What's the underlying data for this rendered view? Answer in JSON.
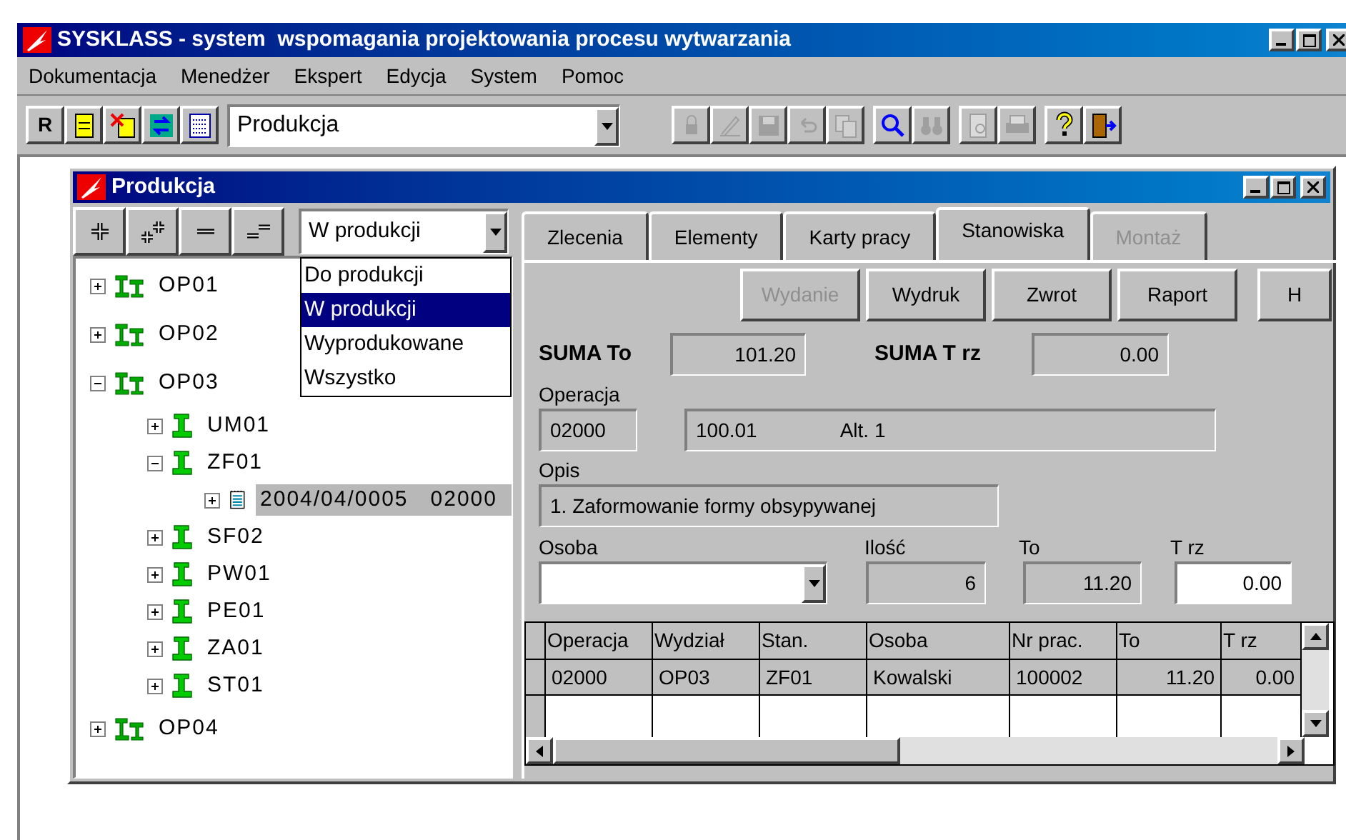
{
  "window": {
    "title": "SYSKLASS - system  wspomagania projektowania procesu wytwarzania"
  },
  "menu": [
    "Dokumentacja",
    "Menedżer",
    "Ekspert",
    "Edycja",
    "System",
    "Pomoc"
  ],
  "toolbar": {
    "letter_button": "R",
    "module": "Produkcja",
    "buttons": [
      {
        "disabled": false
      },
      {
        "disabled": false
      },
      {
        "disabled": false
      },
      {
        "disabled": false
      },
      {
        "disabled": true
      },
      {
        "disabled": true
      },
      {
        "disabled": true
      },
      {
        "disabled": true
      },
      {
        "disabled": true
      },
      {
        "disabled": false
      },
      {
        "disabled": true
      },
      {
        "disabled": true
      },
      {
        "disabled": true
      },
      {
        "disabled": false
      },
      {
        "disabled": false
      }
    ]
  },
  "child_window": {
    "title": "Produkcja",
    "tree_filter": {
      "value": "W produkcji",
      "options": [
        {
          "label": "Do produkcji",
          "selected": false
        },
        {
          "label": "W produkcji",
          "selected": true
        },
        {
          "label": "Wyprodukowane",
          "selected": false
        },
        {
          "label": "Wszystko",
          "selected": false
        }
      ]
    },
    "tree": [
      {
        "kind": "department",
        "label": "OP01",
        "expanded": false,
        "selected": false
      },
      {
        "kind": "department",
        "label": "OP02",
        "expanded": false,
        "selected": false
      },
      {
        "kind": "department",
        "label": "OP03",
        "expanded": true,
        "selected": false,
        "children": [
          {
            "kind": "station",
            "label": "UM01",
            "expanded": false,
            "selected": false
          },
          {
            "kind": "station",
            "label": "ZF01",
            "expanded": true,
            "selected": false,
            "children": [
              {
                "kind": "order",
                "label": "2004/04/0005   02000",
                "expanded": false,
                "selected": true
              }
            ]
          },
          {
            "kind": "station",
            "label": "SF02",
            "expanded": false,
            "selected": false
          },
          {
            "kind": "station",
            "label": "PW01",
            "expanded": false,
            "selected": false
          },
          {
            "kind": "station",
            "label": "PE01",
            "expanded": false,
            "selected": false
          },
          {
            "kind": "station",
            "label": "ZA01",
            "expanded": false,
            "selected": false
          },
          {
            "kind": "station",
            "label": "ST01",
            "expanded": false,
            "selected": false
          }
        ]
      },
      {
        "kind": "department",
        "label": "OP04",
        "expanded": false,
        "selected": false
      }
    ],
    "tabs": [
      {
        "label": "Zlecenia",
        "selected": false,
        "disabled": false
      },
      {
        "label": "Elementy",
        "selected": false,
        "disabled": false
      },
      {
        "label": "Karty pracy",
        "selected": false,
        "disabled": false
      },
      {
        "label": "Stanowiska",
        "selected": true,
        "disabled": false
      },
      {
        "label": "Montaż",
        "selected": false,
        "disabled": true
      }
    ],
    "actions": [
      {
        "label": "Wydanie",
        "disabled": true
      },
      {
        "label": "Wydruk",
        "disabled": false
      },
      {
        "label": "Zwrot",
        "disabled": false
      },
      {
        "label": "Raport",
        "disabled": false
      },
      {
        "label": "H",
        "disabled": false
      }
    ],
    "suma_to": {
      "label": "SUMA To",
      "value": "101.20"
    },
    "suma_trz": {
      "label": "SUMA T rz",
      "value": "0.00"
    },
    "operacja": {
      "label": "Operacja",
      "code": "02000",
      "number": "100.01",
      "alt": "Alt. 1"
    },
    "opis": {
      "label": "Opis",
      "value": "1. Zaformowanie formy obsypywanej"
    },
    "osoba": {
      "label": "Osoba"
    },
    "ilosc": {
      "label": "Ilość",
      "value": "6"
    },
    "to": {
      "label": "To",
      "value": "11.20"
    },
    "trz": {
      "label": "T rz",
      "value": "0.00"
    },
    "table": {
      "columns": [
        "Operacja",
        "Wydział",
        "Stan.",
        "Osoba",
        "Nr prac.",
        "To",
        "T rz"
      ],
      "rows": [
        [
          "02000",
          "OP03",
          "ZF01",
          "Kowalski",
          "100002",
          "11.20",
          "0.00"
        ]
      ]
    }
  }
}
